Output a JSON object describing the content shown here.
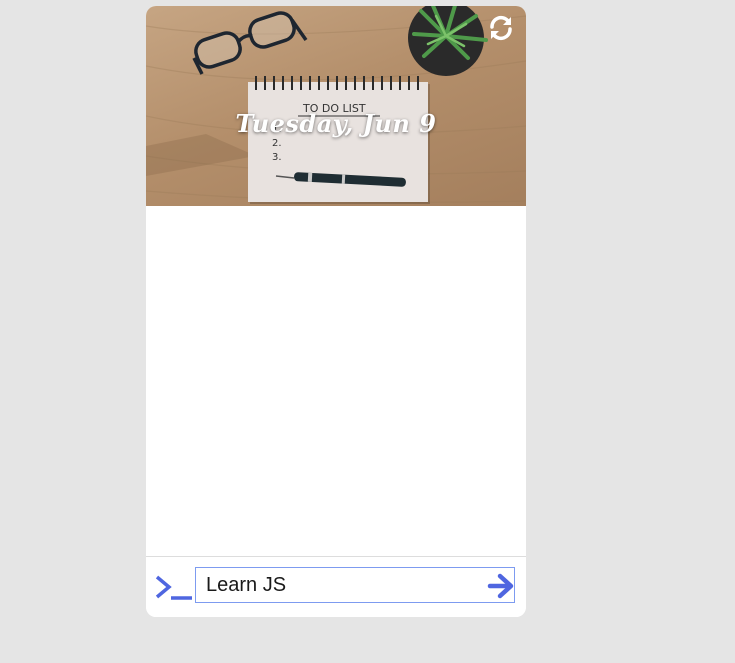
{
  "header": {
    "date": "Tuesday, Jun 9",
    "notepad_heading": "TO DO LIST",
    "notepad_lines": [
      "1.",
      "2.",
      "3."
    ]
  },
  "icons": {
    "refresh": "refresh-icon",
    "prompt": "terminal-prompt-icon",
    "submit": "arrow-right-icon"
  },
  "input": {
    "value": "Learn JS",
    "placeholder": ""
  },
  "colors": {
    "accent": "#4f66e0",
    "page_bg": "#e5e5e5",
    "card_bg": "#ffffff",
    "input_border": "#7d9bf0"
  }
}
